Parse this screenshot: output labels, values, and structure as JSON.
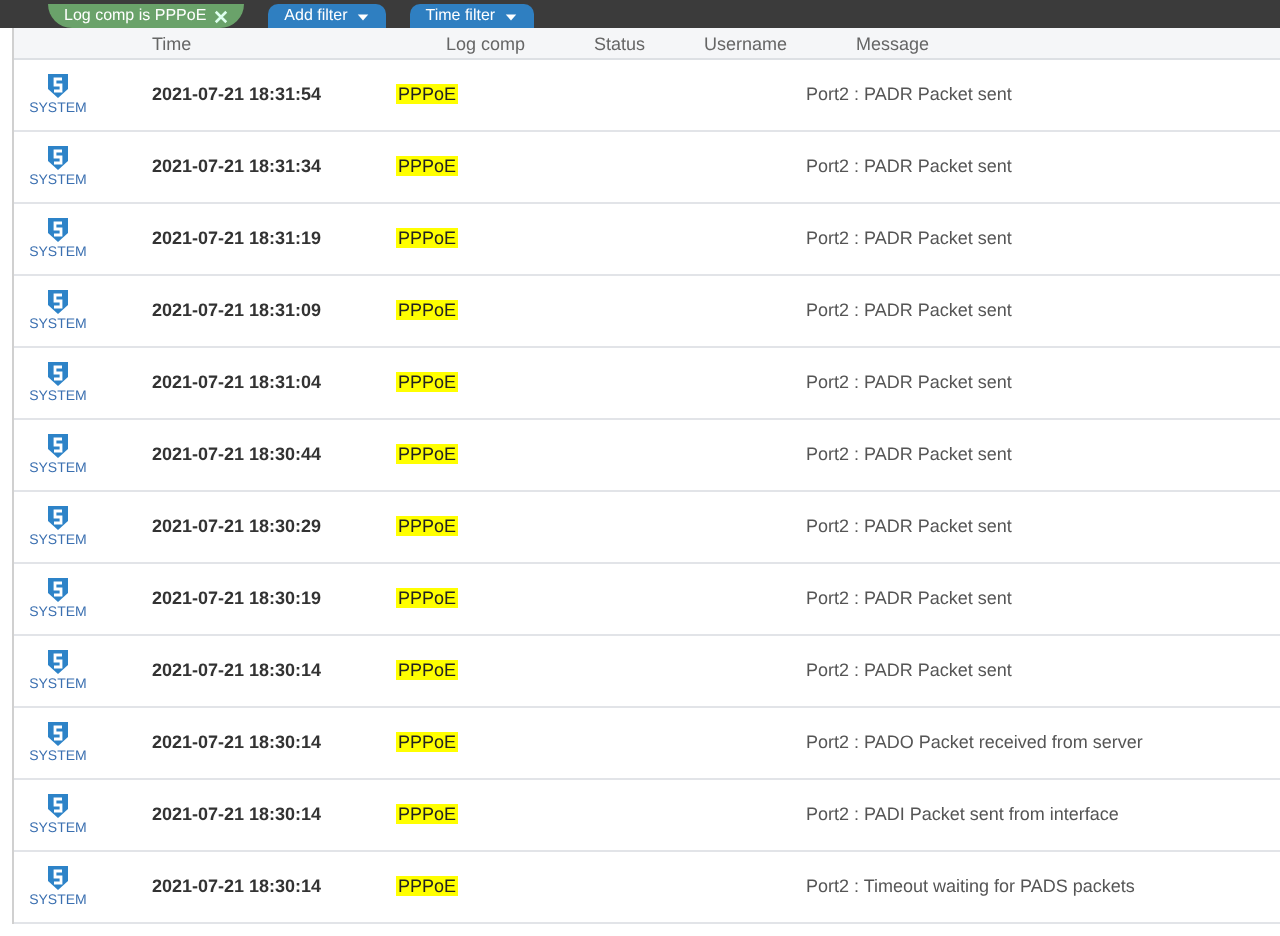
{
  "filters": [
    {
      "label": "Log comp is PPPoE",
      "kind": "chip"
    },
    {
      "label": "Add filter",
      "kind": "dropdown"
    },
    {
      "label": "Time filter",
      "kind": "dropdown"
    }
  ],
  "table": {
    "columns": [
      "Time",
      "Log comp",
      "Status",
      "Username",
      "Message"
    ],
    "rows": [
      {
        "source": "SYSTEM",
        "time": "2021-07-21 18:31:54",
        "log_comp": "PPPoE",
        "message": "Port2 : PADR Packet sent"
      },
      {
        "source": "SYSTEM",
        "time": "2021-07-21 18:31:34",
        "log_comp": "PPPoE",
        "message": "Port2 : PADR Packet sent"
      },
      {
        "source": "SYSTEM",
        "time": "2021-07-21 18:31:19",
        "log_comp": "PPPoE",
        "message": "Port2 : PADR Packet sent"
      },
      {
        "source": "SYSTEM",
        "time": "2021-07-21 18:31:09",
        "log_comp": "PPPoE",
        "message": "Port2 : PADR Packet sent"
      },
      {
        "source": "SYSTEM",
        "time": "2021-07-21 18:31:04",
        "log_comp": "PPPoE",
        "message": "Port2 : PADR Packet sent"
      },
      {
        "source": "SYSTEM",
        "time": "2021-07-21 18:30:44",
        "log_comp": "PPPoE",
        "message": "Port2 : PADR Packet sent"
      },
      {
        "source": "SYSTEM",
        "time": "2021-07-21 18:30:29",
        "log_comp": "PPPoE",
        "message": "Port2 : PADR Packet sent"
      },
      {
        "source": "SYSTEM",
        "time": "2021-07-21 18:30:19",
        "log_comp": "PPPoE",
        "message": "Port2 : PADR Packet sent"
      },
      {
        "source": "SYSTEM",
        "time": "2021-07-21 18:30:14",
        "log_comp": "PPPoE",
        "message": "Port2 : PADR Packet sent"
      },
      {
        "source": "SYSTEM",
        "time": "2021-07-21 18:30:14",
        "log_comp": "PPPoE",
        "message": "Port2 : PADO Packet received from server"
      },
      {
        "source": "SYSTEM",
        "time": "2021-07-21 18:30:14",
        "log_comp": "PPPoE",
        "message": "Port2 : PADI Packet sent from interface"
      },
      {
        "source": "SYSTEM",
        "time": "2021-07-21 18:30:14",
        "log_comp": "PPPoE",
        "message": "Port2 : Timeout waiting for PADS packets"
      }
    ]
  }
}
